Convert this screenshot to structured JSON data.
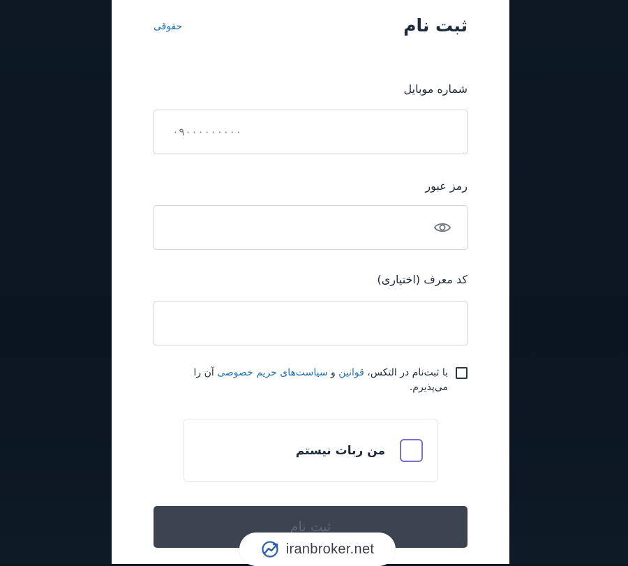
{
  "form": {
    "title": "ثبت نام",
    "legal_link": "حقوقی",
    "mobile_label": "شماره موبایل",
    "mobile_placeholder": "۰۹۰۰۰۰۰۰۰۰۰",
    "password_label": "رمز عبور",
    "password_value": "",
    "referral_label": "کد معرف (اختیاری)",
    "referral_value": "",
    "agree_prefix": "با ثبت‌نام در التکس، ",
    "agree_link_rules": "قوانین",
    "agree_mid": " و ",
    "agree_link_privacy": "سیاست‌های حریم خصوصی",
    "agree_suffix": " آن را می‌پذیرم.",
    "captcha_label": "من ربات نیستم",
    "submit_label": "ثبت نام"
  },
  "watermark": {
    "text": "iranbroker.net"
  },
  "colors": {
    "accent": "#1f6fb8",
    "captcha_border": "#7c6fc8",
    "submit_bg": "#3c4351"
  },
  "icons": {
    "password_toggle": "eye-icon",
    "watermark_logo": "trend-chart-icon"
  }
}
